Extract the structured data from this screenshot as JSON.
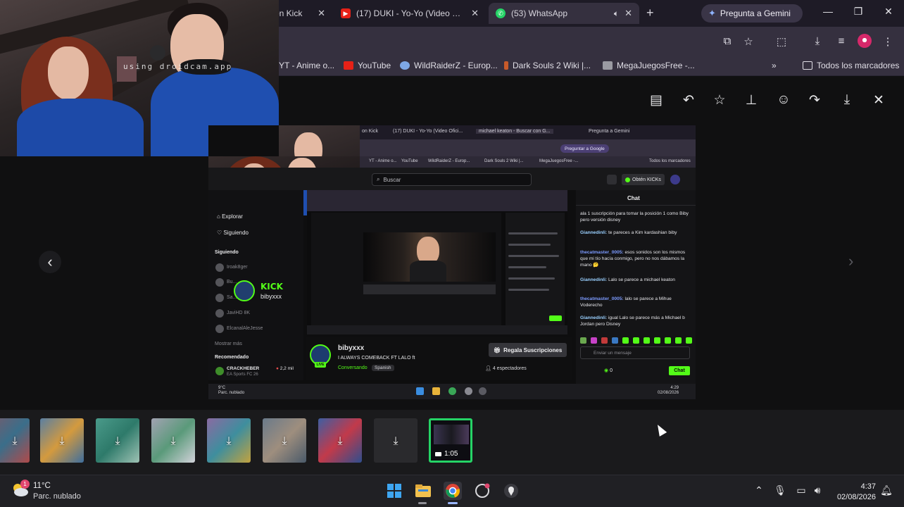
{
  "browser": {
    "tabs": [
      {
        "title": "on Kick",
        "active": false,
        "favicon": "kick"
      },
      {
        "title": "(17) DUKI - Yo-Yo (Video Oficial)",
        "active": false,
        "favicon": "youtube"
      },
      {
        "title": "(53) WhatsApp",
        "active": true,
        "favicon": "whatsapp"
      }
    ],
    "new_tab": "+",
    "gemini_label": "Pregunta a Gemini",
    "bookmarks": [
      {
        "label": "YT - Anime o..."
      },
      {
        "label": "YouTube"
      },
      {
        "label": "WildRaiderZ - Europ..."
      },
      {
        "label": "Dark Souls 2 Wiki |..."
      },
      {
        "label": "MegaJuegosFree -..."
      }
    ],
    "bookmarks_more": "»",
    "all_bookmarks": "Todos los marcadores"
  },
  "webcam": {
    "watermark": "using droidcam.app"
  },
  "viewer": {
    "prev_arrow": "‹",
    "next_arrow": "›"
  },
  "shot": {
    "tabs": [
      "on Kick",
      "(17) DUKI - Yo-Yo (Video Ofici...",
      "michael keaton - Buscar con G...",
      "Pregunta a Gemini"
    ],
    "ask_google": "Preguntar a Google",
    "bookmarks": [
      "YT - Anime o...",
      "YouTube",
      "WildRaiderZ - Europ...",
      "Dark Souls 2 Wiki |...",
      "MegaJuegosFree -...",
      "Todos los marcadores"
    ],
    "search_placeholder": "Buscar",
    "obtain_kicks": "Obtén KICKs",
    "sidebar": {
      "explore": "Explorar",
      "following": "Siguiendo",
      "following_section": "Siguiendo",
      "channels": [
        "Iroak8ger",
        "Bu...",
        "Sa...",
        "JaviHD 8K",
        "ElcanalAleJesse"
      ],
      "show_more": "Mostrar más",
      "recommended": "Recomendado",
      "rec_name": "CRACKHEBER",
      "rec_game": "EA Sports FC 26",
      "rec_viewers": "2,2 mil"
    },
    "kick_logo": "KICK",
    "kick_user": "bibyxxx",
    "stream": {
      "streamer": "bibyxxx",
      "title": "I ALWAYS COMEBACK FT LALO ft",
      "category": "Conversando",
      "language": "Spanish",
      "live": "LIVE",
      "subs_button": "Regala Suscripciones",
      "viewers": "4 espectadores"
    },
    "chat": {
      "title": "Chat",
      "messages": [
        {
          "user": "",
          "text": "ala 1 suscripción para tomar la posición 1 como Biby pero versión disney",
          "color": "#e6e6ea"
        },
        {
          "user": "Giannedinli:",
          "text": "te pareces a Kim kardashian biby",
          "color": "#9ad0ff"
        },
        {
          "user": "thecatmaster_0005:",
          "text": "esos sonidos son los mismos que mi tío hacía conmigo, pero no nos dábamos la mano 🤔",
          "color": "#7c9bff"
        },
        {
          "user": "Giannedinli:",
          "text": "Lalo se parece a michael keaton",
          "color": "#9ad0ff"
        },
        {
          "user": "thecatmaster_0005:",
          "text": "lalo se parece a Mihue Voderecho",
          "color": "#7c9bff"
        },
        {
          "user": "Giannedinli:",
          "text": "igual Lalo se parece más a Michael b Jordan pero Disney",
          "color": "#9ad0ff"
        }
      ],
      "input_placeholder": "Enviar un mensaje",
      "kicks_count": "0",
      "chat_button": "Chat"
    },
    "taskbar": {
      "weather": "9°C",
      "condition": "Parc. nublado",
      "time": "4:29",
      "date": "02/08/2026"
    }
  },
  "thumbnails": {
    "download_glyph": "⤓",
    "selected_duration": "1:05"
  },
  "taskbar": {
    "temperature": "11°C",
    "condition": "Parc. nublado",
    "weather_badge": "1",
    "time": "4:37",
    "date": "02/08/2026"
  },
  "colors": {
    "kick_green": "#53fc18",
    "whatsapp_green": "#25d366",
    "chrome_dark": "#1e1b26",
    "chrome_mid": "#35303f"
  }
}
